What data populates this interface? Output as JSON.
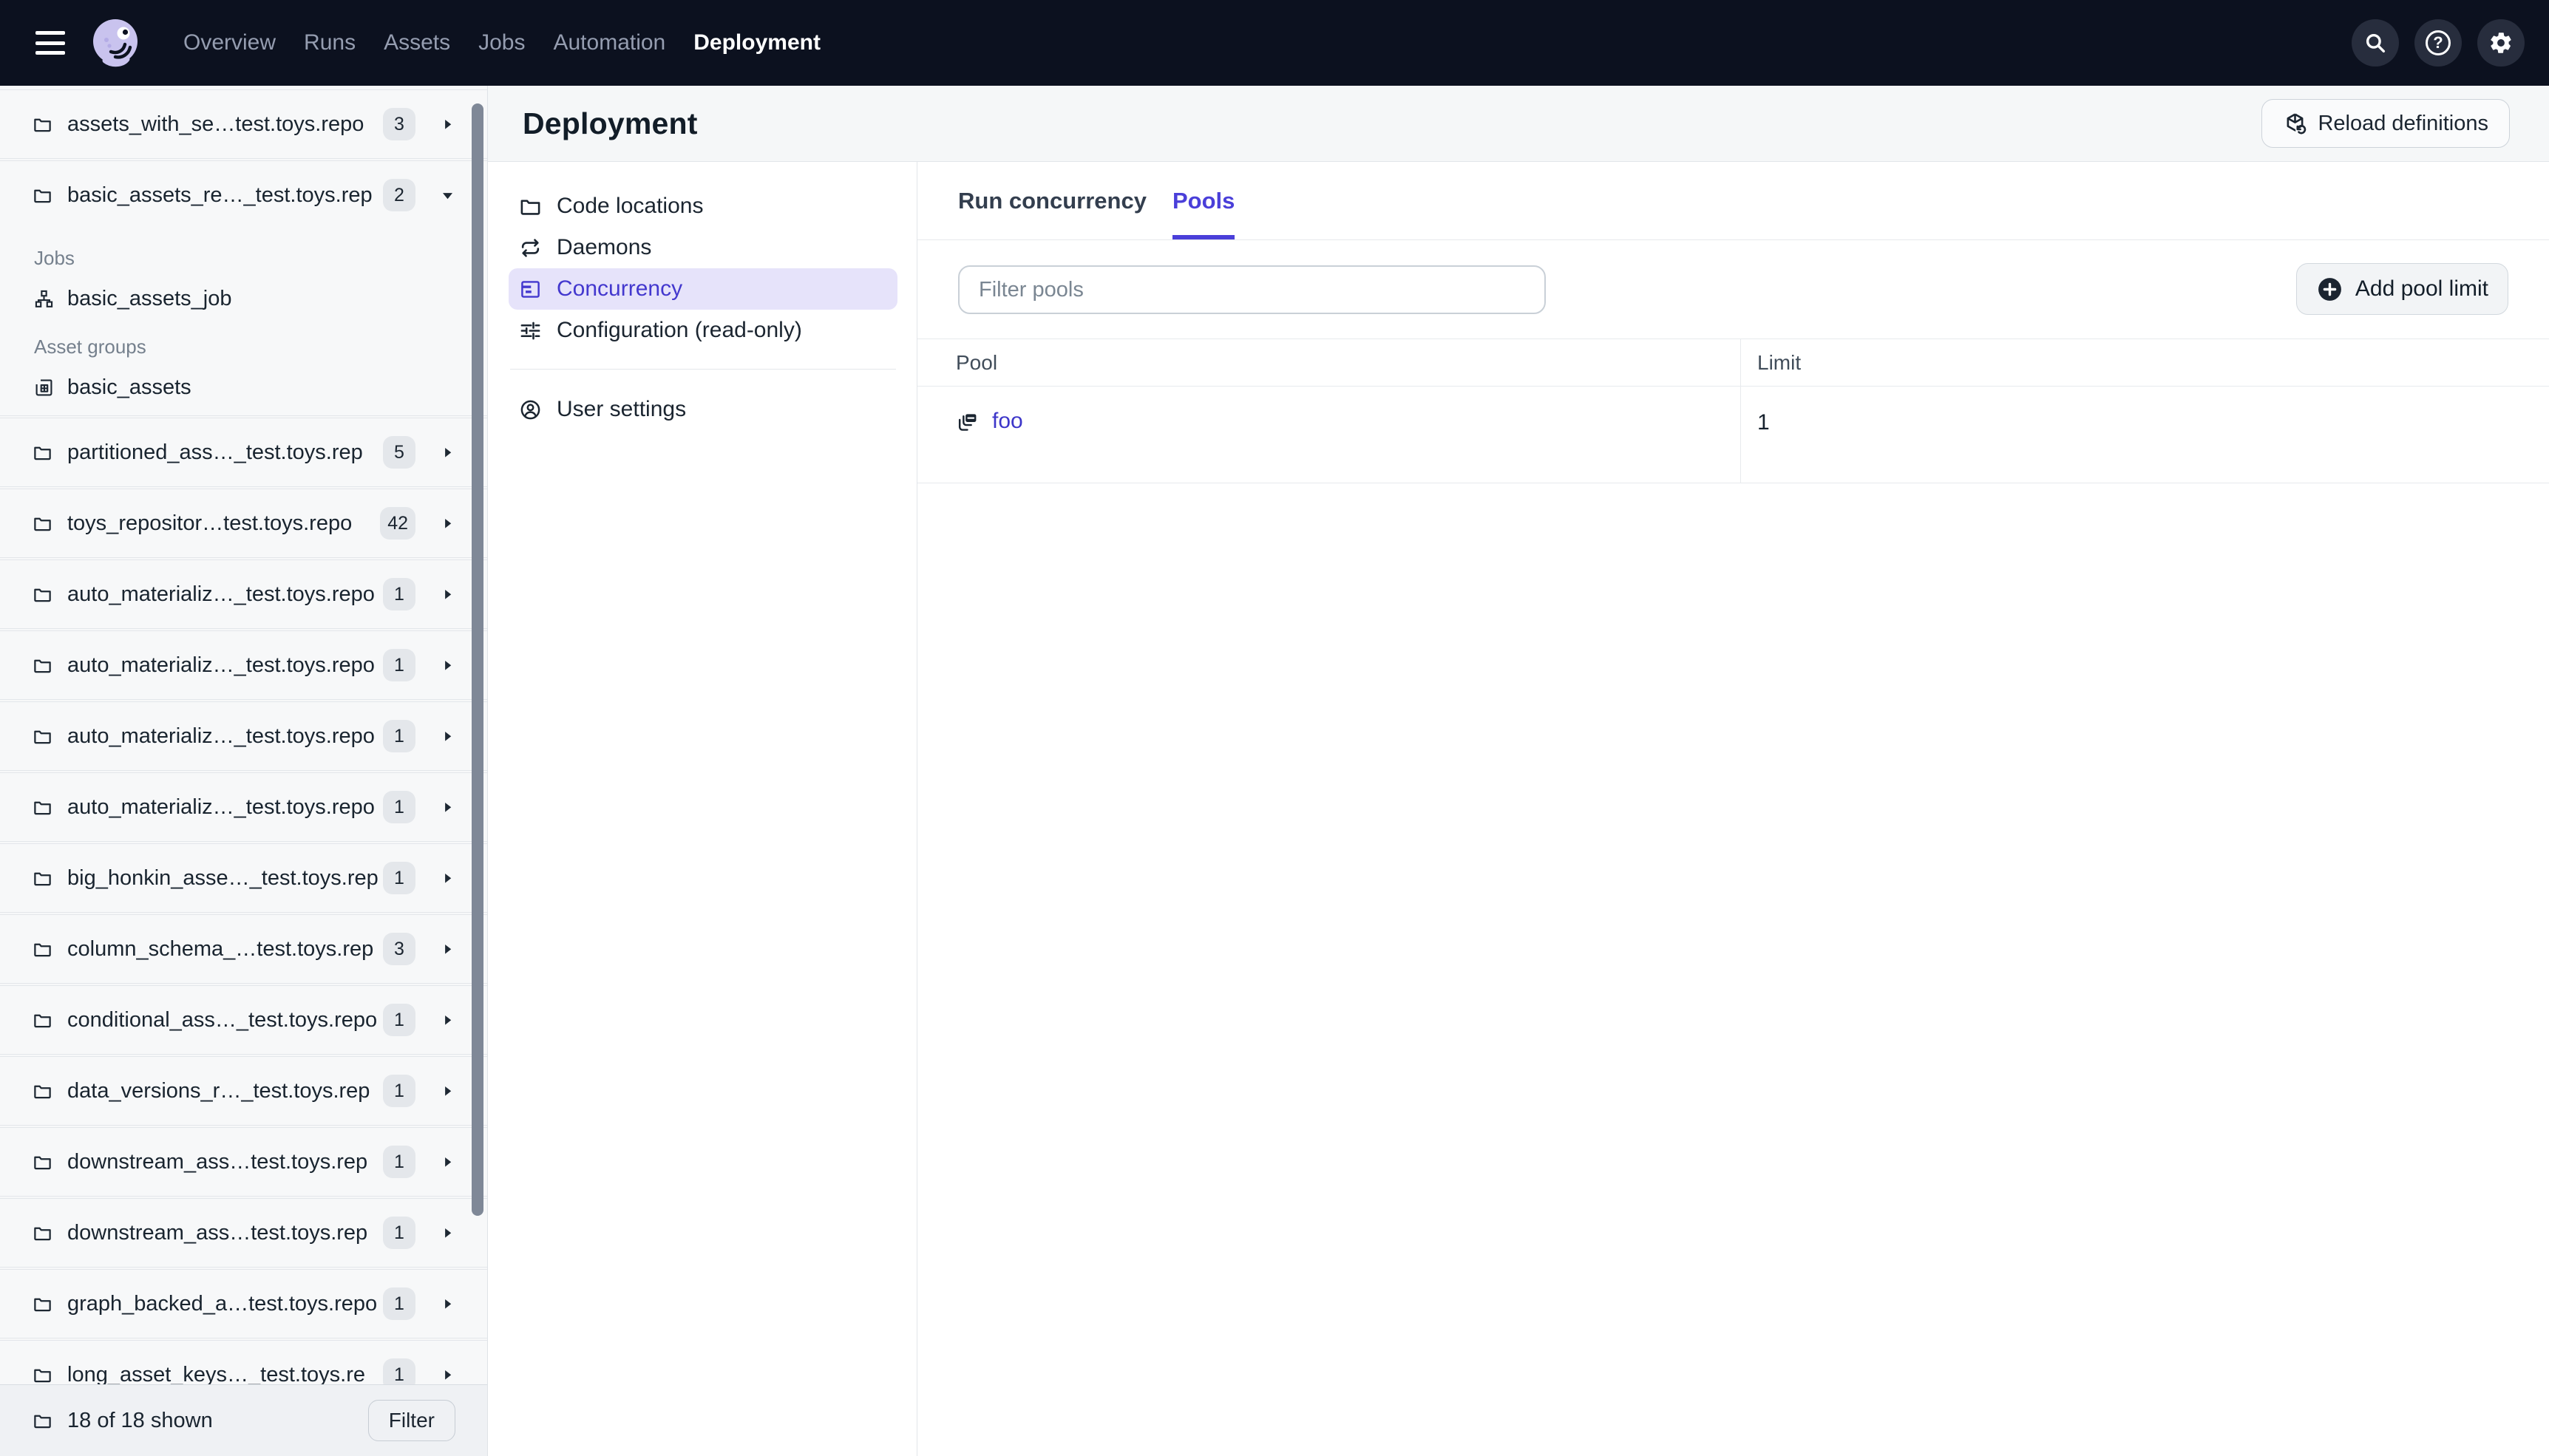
{
  "topnav": {
    "links": [
      {
        "label": "Overview",
        "active": false
      },
      {
        "label": "Runs",
        "active": false
      },
      {
        "label": "Assets",
        "active": false
      },
      {
        "label": "Jobs",
        "active": false
      },
      {
        "label": "Automation",
        "active": false
      },
      {
        "label": "Deployment",
        "active": true
      }
    ],
    "icon_buttons": [
      {
        "name": "search",
        "icon": "search"
      },
      {
        "name": "help",
        "icon": "help"
      },
      {
        "name": "settings",
        "icon": "gear"
      }
    ]
  },
  "sidebar": {
    "repos": [
      {
        "name": "assets_with_se…test.toys.repo",
        "badge": "3",
        "expanded": false
      },
      {
        "name": "basic_assets_re…_test.toys.rep",
        "badge": "2",
        "expanded": true,
        "sections": [
          {
            "label": "Jobs",
            "icon": "job",
            "items": [
              "basic_assets_job"
            ]
          },
          {
            "label": "Asset groups",
            "icon": "asset-group",
            "items": [
              "basic_assets"
            ]
          }
        ]
      },
      {
        "name": "partitioned_ass…_test.toys.rep",
        "badge": "5",
        "expanded": false
      },
      {
        "name": "toys_repositor…test.toys.repo",
        "badge": "42",
        "expanded": false
      },
      {
        "name": "auto_materializ…_test.toys.repo",
        "badge": "1",
        "expanded": false
      },
      {
        "name": "auto_materializ…_test.toys.repo",
        "badge": "1",
        "expanded": false
      },
      {
        "name": "auto_materializ…_test.toys.repo",
        "badge": "1",
        "expanded": false
      },
      {
        "name": "auto_materializ…_test.toys.repo",
        "badge": "1",
        "expanded": false
      },
      {
        "name": "big_honkin_asse…_test.toys.rep",
        "badge": "1",
        "expanded": false
      },
      {
        "name": "column_schema_…test.toys.rep",
        "badge": "3",
        "expanded": false
      },
      {
        "name": "conditional_ass…_test.toys.repo",
        "badge": "1",
        "expanded": false
      },
      {
        "name": "data_versions_r…_test.toys.rep",
        "badge": "1",
        "expanded": false
      },
      {
        "name": "downstream_ass…test.toys.rep",
        "badge": "1",
        "expanded": false
      },
      {
        "name": "downstream_ass…test.toys.rep",
        "badge": "1",
        "expanded": false
      },
      {
        "name": "graph_backed_a…test.toys.repo",
        "badge": "1",
        "expanded": false
      },
      {
        "name": "long_asset_keys…_test.toys.re",
        "badge": "1",
        "expanded": false
      }
    ],
    "footer": {
      "count_text": "18 of 18 shown",
      "filter_label": "Filter"
    }
  },
  "header": {
    "title": "Deployment",
    "reload_label": "Reload definitions"
  },
  "deployment_nav": {
    "items": [
      {
        "label": "Code locations",
        "icon": "folder",
        "selected": false
      },
      {
        "label": "Daemons",
        "icon": "daemons",
        "selected": false
      },
      {
        "label": "Concurrency",
        "icon": "concurrency",
        "selected": true
      },
      {
        "label": "Configuration (read-only)",
        "icon": "configuration",
        "selected": false
      }
    ],
    "user_settings": {
      "label": "User settings",
      "icon": "user"
    }
  },
  "concurrency": {
    "tabs": [
      {
        "label": "Run concurrency",
        "active": false
      },
      {
        "label": "Pools",
        "active": true
      }
    ],
    "filter_placeholder": "Filter pools",
    "add_button_label": "Add pool limit",
    "table": {
      "columns": [
        "Pool",
        "Limit"
      ],
      "rows": [
        {
          "pool": "foo",
          "limit": "1"
        }
      ]
    }
  },
  "colors": {
    "accent": "#4A3FD9",
    "topnav_bg": "#0C111F",
    "selected_nav_bg": "#E6E3FA",
    "link": "#3D36C9"
  }
}
